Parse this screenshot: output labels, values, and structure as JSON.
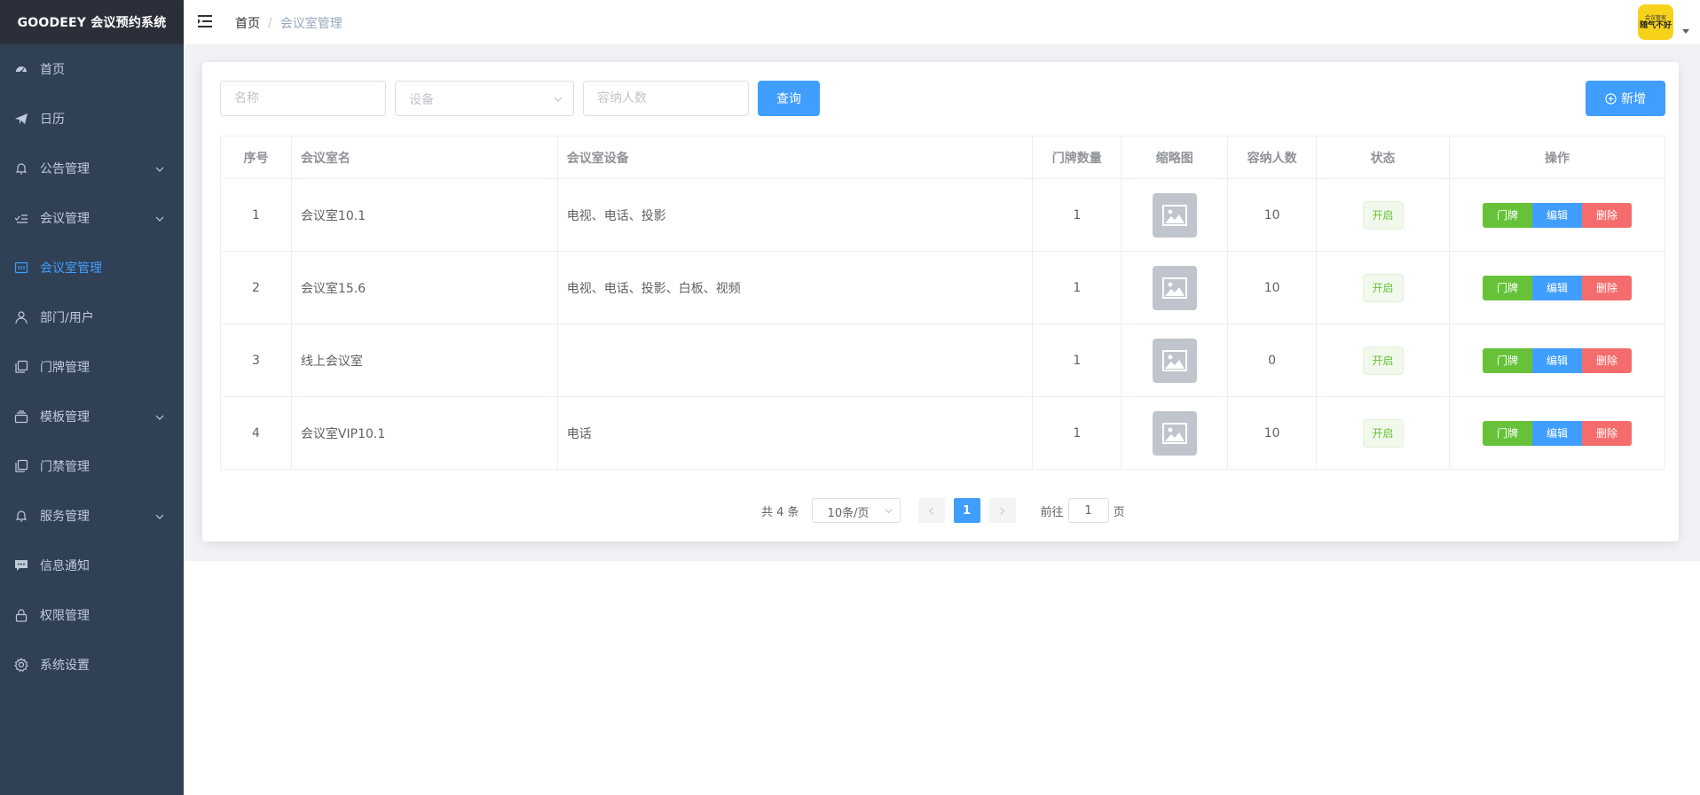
{
  "app": {
    "title": "GOODEEY 会议预约系统"
  },
  "sidebar": {
    "items": [
      {
        "label": "首页",
        "icon": "dashboard-icon",
        "expandable": false,
        "active": false
      },
      {
        "label": "日历",
        "icon": "paper-plane-icon",
        "expandable": false,
        "active": false
      },
      {
        "label": "公告管理",
        "icon": "bell-icon",
        "expandable": true,
        "active": false
      },
      {
        "label": "会议管理",
        "icon": "checklist-icon",
        "expandable": true,
        "active": false
      },
      {
        "label": "会议室管理",
        "icon": "board-icon",
        "expandable": false,
        "active": true
      },
      {
        "label": "部门/用户",
        "icon": "user-icon",
        "expandable": false,
        "active": false
      },
      {
        "label": "门牌管理",
        "icon": "copy-icon",
        "expandable": false,
        "active": false
      },
      {
        "label": "模板管理",
        "icon": "template-icon",
        "expandable": true,
        "active": false
      },
      {
        "label": "门禁管理",
        "icon": "copy-icon",
        "expandable": false,
        "active": false
      },
      {
        "label": "服务管理",
        "icon": "bell-icon",
        "expandable": true,
        "active": false
      },
      {
        "label": "信息通知",
        "icon": "chat-icon",
        "expandable": false,
        "active": false
      },
      {
        "label": "权限管理",
        "icon": "lock-icon",
        "expandable": false,
        "active": false
      },
      {
        "label": "系统设置",
        "icon": "gear-icon",
        "expandable": false,
        "active": false
      }
    ]
  },
  "header": {
    "breadcrumb": {
      "home": "首页",
      "separator": "/",
      "current": "会议室管理"
    },
    "avatar": {
      "top_text": "会议管家",
      "main_text": "随气不好"
    }
  },
  "filters": {
    "name_placeholder": "名称",
    "device_placeholder": "设备",
    "capacity_placeholder": "容纳人数",
    "query_label": "查询",
    "add_label": "新增"
  },
  "table": {
    "columns": [
      "序号",
      "会议室名",
      "会议室设备",
      "门牌数量",
      "缩略图",
      "容纳人数",
      "状态",
      "操作"
    ],
    "rows": [
      {
        "index": "1",
        "name": "会议室10.1",
        "devices": "电视、电话、投影",
        "doorplates": "1",
        "capacity": "10",
        "status": "开启"
      },
      {
        "index": "2",
        "name": "会议室15.6",
        "devices": "电视、电话、投影、白板、视频",
        "doorplates": "1",
        "capacity": "10",
        "status": "开启"
      },
      {
        "index": "3",
        "name": "线上会议室",
        "devices": "",
        "doorplates": "1",
        "capacity": "0",
        "status": "开启"
      },
      {
        "index": "4",
        "name": "会议室VIP10.1",
        "devices": "电话",
        "doorplates": "1",
        "capacity": "10",
        "status": "开启"
      }
    ],
    "actions": {
      "doorplate": "门牌",
      "edit": "编辑",
      "delete": "删除"
    }
  },
  "pagination": {
    "total_text": "共 4 条",
    "page_size": "10条/页",
    "current_page": "1",
    "goto_prefix": "前往",
    "goto_value": "1",
    "goto_suffix": "页"
  },
  "colors": {
    "sidebar_bg": "#304156",
    "brand_bg": "#2b2f3a",
    "primary": "#409eff",
    "success": "#67c23a",
    "danger": "#f56c6c"
  }
}
